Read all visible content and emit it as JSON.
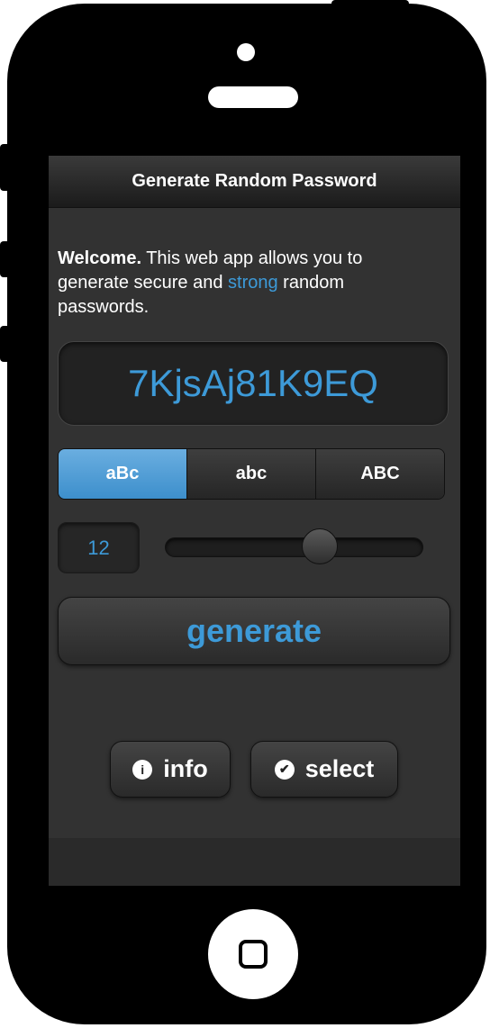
{
  "header": {
    "title": "Generate Random Password"
  },
  "intro": {
    "bold": "Welcome.",
    "text_before": " This web app allows you to generate secure and ",
    "highlight": "strong",
    "text_after": " random passwords."
  },
  "password": {
    "value": "7KjsAj81K9EQ"
  },
  "case_options": {
    "items": [
      {
        "label": "aBc",
        "selected": true
      },
      {
        "label": "abc",
        "selected": false
      },
      {
        "label": "ABC",
        "selected": false
      }
    ]
  },
  "length": {
    "value": "12",
    "slider_fraction": 0.6
  },
  "actions": {
    "generate_label": "generate",
    "info_label": "info",
    "info_icon": "i",
    "select_label": "select",
    "select_icon": "✔"
  },
  "colors": {
    "accent": "#3d9ad8",
    "active_segment": "#5aa3dc"
  },
  "icons": {
    "info": "info-icon",
    "select": "checkmark-icon"
  }
}
